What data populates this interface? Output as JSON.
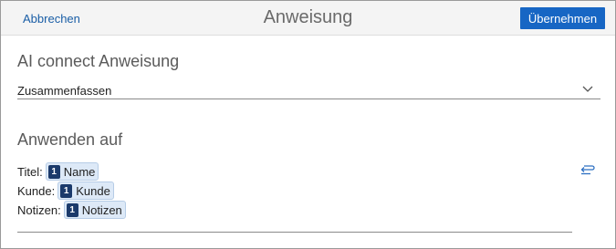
{
  "header": {
    "cancel_label": "Abbrechen",
    "title": "Anweisung",
    "apply_label": "Übernehmen"
  },
  "instruction": {
    "section_title": "AI connect Anweisung",
    "selected_value": "Zusammenfassen"
  },
  "apply_to": {
    "section_title": "Anwenden auf",
    "fields": [
      {
        "label": "Titel:",
        "token_index": "1",
        "token_name": "Name"
      },
      {
        "label": "Kunde:",
        "token_index": "1",
        "token_name": "Kunde"
      },
      {
        "label": "Notizen:",
        "token_index": "1",
        "token_name": "Notizen"
      }
    ]
  },
  "icons": {
    "chevron": "chevron-down-icon",
    "edit": "edit-mapping-icon"
  },
  "colors": {
    "accent": "#1766c4",
    "link": "#1a5ea6",
    "token_bg": "#dde9f7",
    "badge_bg": "#1b3a6b"
  }
}
